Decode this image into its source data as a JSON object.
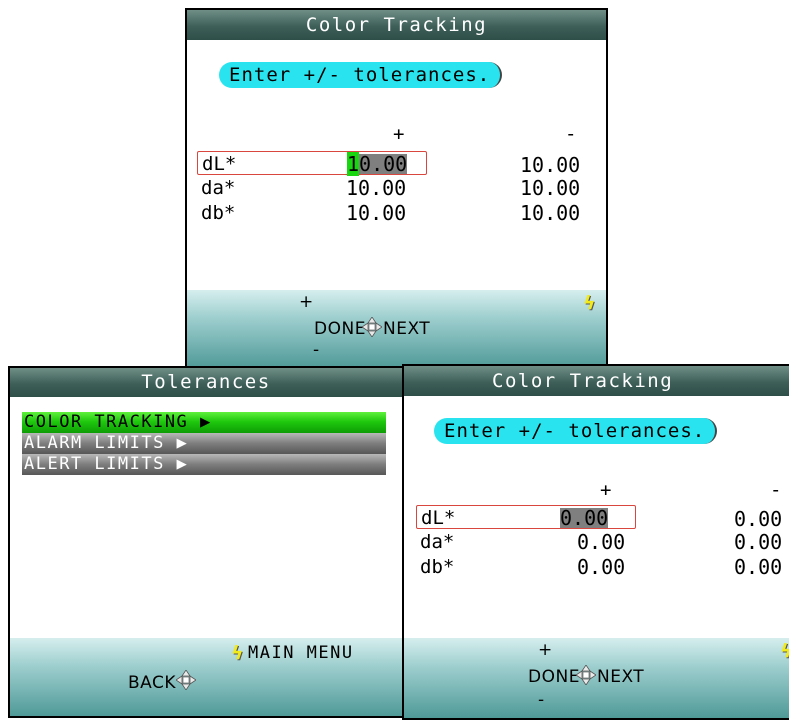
{
  "screens": {
    "top": {
      "title": "Color Tracking",
      "prompt": "Enter +/- tolerances.",
      "col_plus": "+",
      "col_minus": "-",
      "rows": [
        {
          "label": "dL*",
          "plus_cursor": "1",
          "plus_rest": "0.00",
          "minus": "10.00"
        },
        {
          "label": "da*",
          "plus": "10.00",
          "minus": "10.00"
        },
        {
          "label": "db*",
          "plus": "10.00",
          "minus": "10.00"
        }
      ],
      "footer": {
        "up": "+",
        "left": "DONE",
        "right": "NEXT",
        "down": "-"
      }
    },
    "left": {
      "title": "Tolerances",
      "menu": [
        "COLOR TRACKING ▶",
        "ALARM LIMITS ▶",
        "ALERT LIMITS ▶"
      ],
      "footer": {
        "right_label": "MAIN MENU",
        "back": "BACK"
      }
    },
    "right": {
      "title": "Color Tracking",
      "prompt": "Enter +/- tolerances.",
      "col_plus": "+",
      "col_minus": "-",
      "rows": [
        {
          "label": "dL*",
          "plus_cursor": " ",
          "plus_rest": "0.00",
          "minus": "0.00"
        },
        {
          "label": "da*",
          "plus": "0.00",
          "minus": "0.00"
        },
        {
          "label": "db*",
          "plus": "0.00",
          "minus": "0.00"
        }
      ],
      "footer": {
        "up": "+",
        "left": "DONE",
        "right": "NEXT",
        "down": "-"
      }
    }
  },
  "colors": {
    "prompt_bg": "#29e4ee",
    "cursor": "#18d60f",
    "selected_menu": "#1fc90e",
    "selection_border": "#d8463d",
    "bolt": "#f2ea1a"
  },
  "icons": [
    "dpad-icon",
    "lightning-icon",
    "menu-arrow-icon"
  ]
}
